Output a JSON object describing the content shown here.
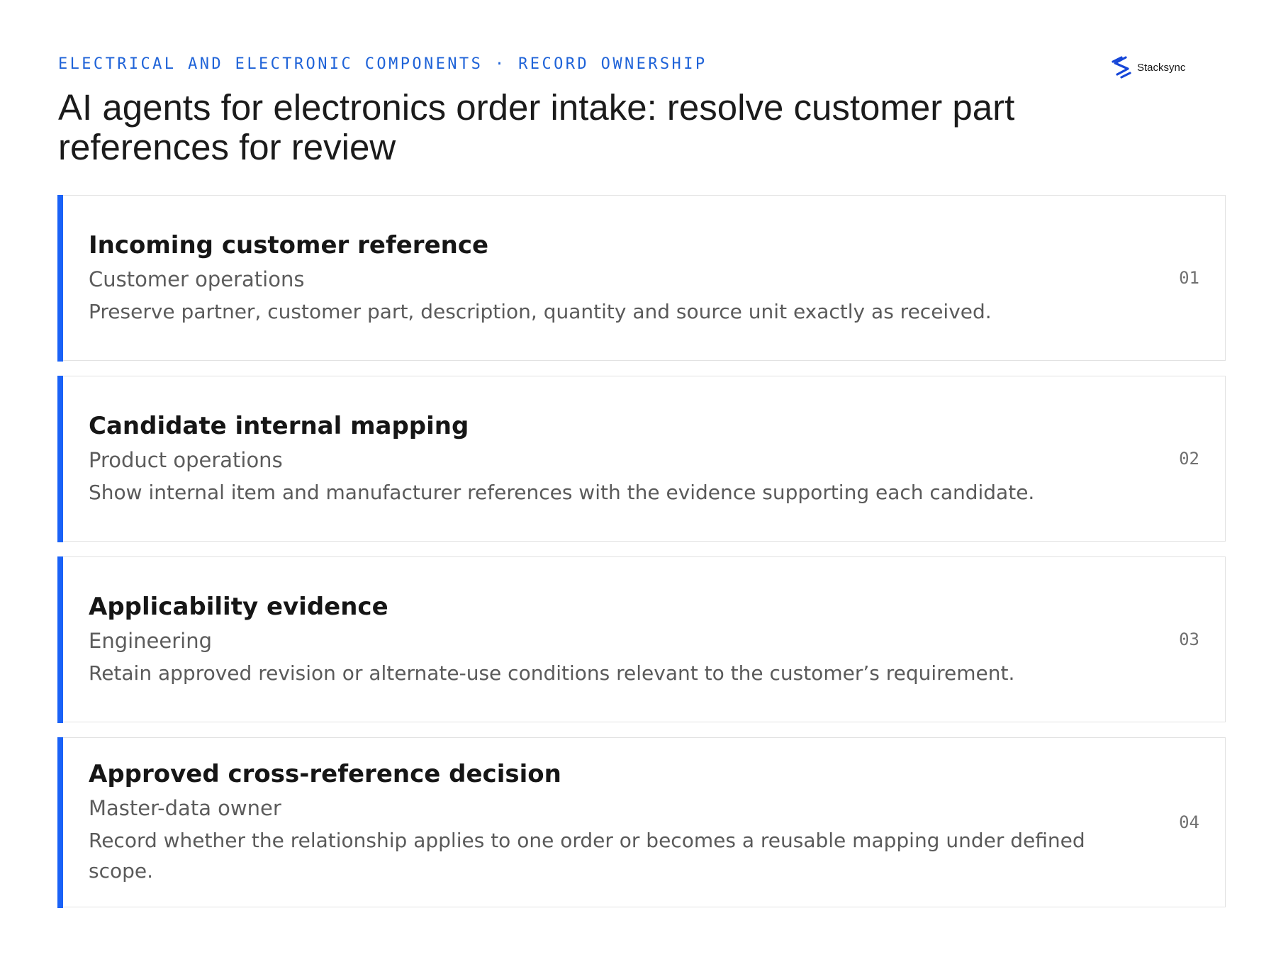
{
  "header": {
    "eyebrow": "ELECTRICAL AND ELECTRONIC COMPONENTS · RECORD OWNERSHIP",
    "title": "AI agents for electronics order intake: resolve customer part references for review"
  },
  "brand": {
    "name": "Stacksync",
    "logo_icon": "stacksync-logo-icon",
    "logo_color": "#1646d8"
  },
  "colors": {
    "accent": "#1a62f7",
    "eyebrow": "#1f63d8"
  },
  "cards": [
    {
      "title": "Incoming customer reference",
      "owner": "Customer operations",
      "description": "Preserve partner, customer part, description, quantity and source unit exactly as received.",
      "number": "01"
    },
    {
      "title": "Candidate internal mapping",
      "owner": "Product operations",
      "description": "Show internal item and manufacturer references with the evidence supporting each candidate.",
      "number": "02"
    },
    {
      "title": "Applicability evidence",
      "owner": "Engineering",
      "description": "Retain approved revision or alternate-use conditions relevant to the customer’s requirement.",
      "number": "03"
    },
    {
      "title": "Approved cross-reference decision",
      "owner": "Master-data owner",
      "description": "Record whether the relationship applies to one order or becomes a reusable mapping under defined scope.",
      "number": "04"
    }
  ]
}
